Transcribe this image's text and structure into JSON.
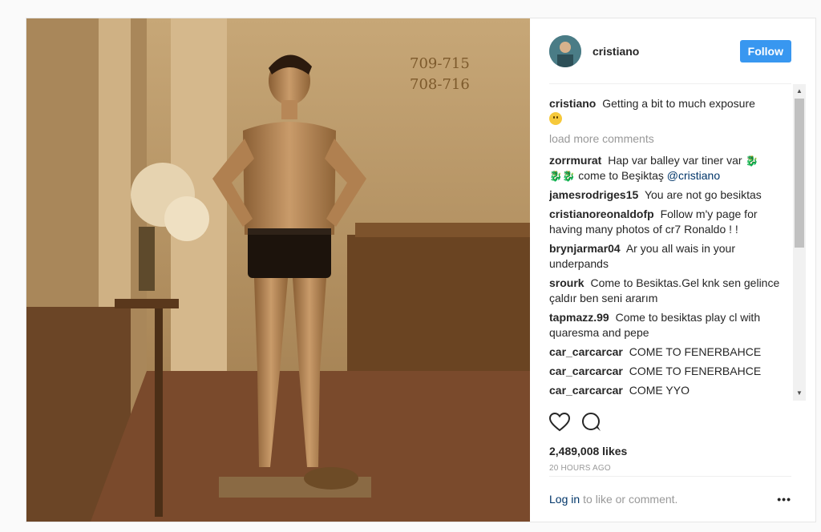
{
  "post": {
    "image_alt": "Sepia photo of a man in black briefs standing in a hotel corridor",
    "room_sign": [
      "709-715",
      "708-716"
    ]
  },
  "header": {
    "username": "cristiano",
    "follow_label": "Follow"
  },
  "caption": {
    "user": "cristiano",
    "text": "Getting a bit to much exposure"
  },
  "load_more": "load more comments",
  "comments": [
    {
      "user": "zorrmurat",
      "pre": "Hap var balley var tiner var",
      "line2": "come to Beşiktaş",
      "mention": "@cristiano"
    },
    {
      "user": "jamesrodriges15",
      "text": "You are not go besiktas"
    },
    {
      "user": "cristianoreonaldofp",
      "text": "Follow m'y page for having many photos of cr7 Ronaldo ! !"
    },
    {
      "user": "brynjarmar04",
      "text": "Ar you all wais in your underpands"
    },
    {
      "user": "srourk",
      "text": "Come to Besiktas.Gel knk sen gelince çaldır ben seni ararım"
    },
    {
      "user": "tapmazz.99",
      "text": "Come to besiktas play cl with quaresma and pepe"
    },
    {
      "user": "car_carcarcar",
      "text": "COME TO FENERBAHCE"
    },
    {
      "user": "car_carcarcar",
      "text": "COME TO FENERBAHCE"
    },
    {
      "user": "car_carcarcar",
      "text": "COME YYO"
    }
  ],
  "likes": "2,489,008 likes",
  "time": "20 HOURS AGO",
  "footer": {
    "login": "Log in",
    "rest": "to like or comment.",
    "more": "•••"
  },
  "colors": {
    "accent": "#3897f0",
    "link": "#003569",
    "muted": "#999999"
  },
  "icons": [
    "heart-icon",
    "comment-icon",
    "more-options-icon"
  ]
}
